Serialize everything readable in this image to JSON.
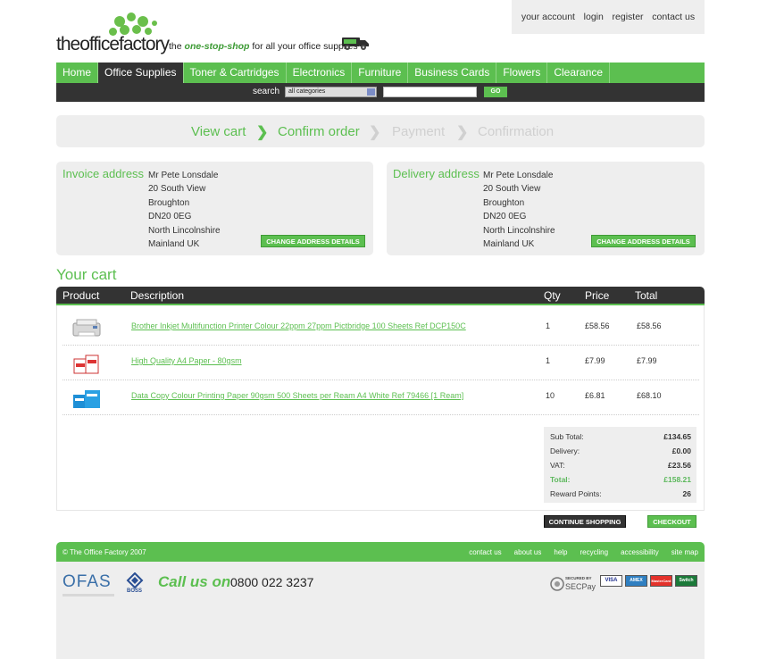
{
  "header": {
    "logo_text": "theofficefactory",
    "tagline_prefix": "the",
    "tagline_em": "one-stop-shop",
    "tagline_suffix": "for all your office supplies",
    "account_links": [
      "your account",
      "login",
      "register",
      "contact us"
    ]
  },
  "nav": {
    "items": [
      "Home",
      "Office Supplies",
      "Toner & Cartridges",
      "Electronics",
      "Furniture",
      "Business Cards",
      "Flowers",
      "Clearance"
    ],
    "active": "Office Supplies"
  },
  "search": {
    "label": "search",
    "category_selected": "all categories",
    "query": "",
    "go_label": "GO"
  },
  "steps": [
    {
      "label": "View cart",
      "state": "done"
    },
    {
      "label": "Confirm order",
      "state": "done"
    },
    {
      "label": "Payment",
      "state": "todo"
    },
    {
      "label": "Confirmation",
      "state": "todo"
    }
  ],
  "invoice": {
    "title": "Invoice address",
    "lines": [
      "Mr Pete Lonsdale",
      "20 South View",
      "Broughton",
      "DN20 0EG",
      "North Lincolnshire",
      "Mainland UK"
    ],
    "button": "CHANGE ADDRESS DETAILS"
  },
  "delivery": {
    "title": "Delivery address",
    "lines": [
      "Mr Pete Lonsdale",
      "20 South View",
      "Broughton",
      "DN20 0EG",
      "North Lincolnshire",
      "Mainland UK"
    ],
    "button": "CHANGE ADDRESS DETAILS"
  },
  "cart": {
    "title": "Your cart",
    "headers": {
      "product": "Product",
      "description": "Description",
      "qty": "Qty",
      "price": "Price",
      "total": "Total"
    },
    "rows": [
      {
        "description": "Brother Inkjet Multifunction Printer Colour 22ppm 27ppm Pictbridge 100 Sheets Ref DCP150C",
        "qty": "1",
        "price": "£58.56",
        "total": "£58.56"
      },
      {
        "description": "High Quality A4 Paper - 80gsm",
        "qty": "1",
        "price": "£7.99",
        "total": "£7.99"
      },
      {
        "description": "Data Copy Colour Printing Paper 90gsm 500 Sheets per Ream A4 White Ref 79466 [1 Ream]",
        "qty": "10",
        "price": "£6.81",
        "total": "£68.10"
      }
    ],
    "totals": [
      {
        "label": "Sub Total:",
        "value": "£134.65"
      },
      {
        "label": "Delivery:",
        "value": "£0.00"
      },
      {
        "label": "VAT:",
        "value": "£23.56"
      },
      {
        "label": "Total:",
        "value": "£158.21"
      },
      {
        "label": "Reward Points:",
        "value": "26"
      }
    ],
    "continue_label": "CONTINUE SHOPPING",
    "checkout_label": "CHECKOUT"
  },
  "footer": {
    "copyright": "© The Office Factory 2007",
    "links": [
      "contact us",
      "about us",
      "help",
      "recycling",
      "accessibility",
      "site map"
    ],
    "ofas": "OFAS",
    "boss": "BOSS",
    "call_label": "Call us on",
    "phone": "0800 022 3237",
    "secpay_top": "SECURED BY",
    "secpay_name": "SECPay",
    "cards": [
      "VISA",
      "AMEX",
      "MasterCard",
      "Switch"
    ]
  }
}
